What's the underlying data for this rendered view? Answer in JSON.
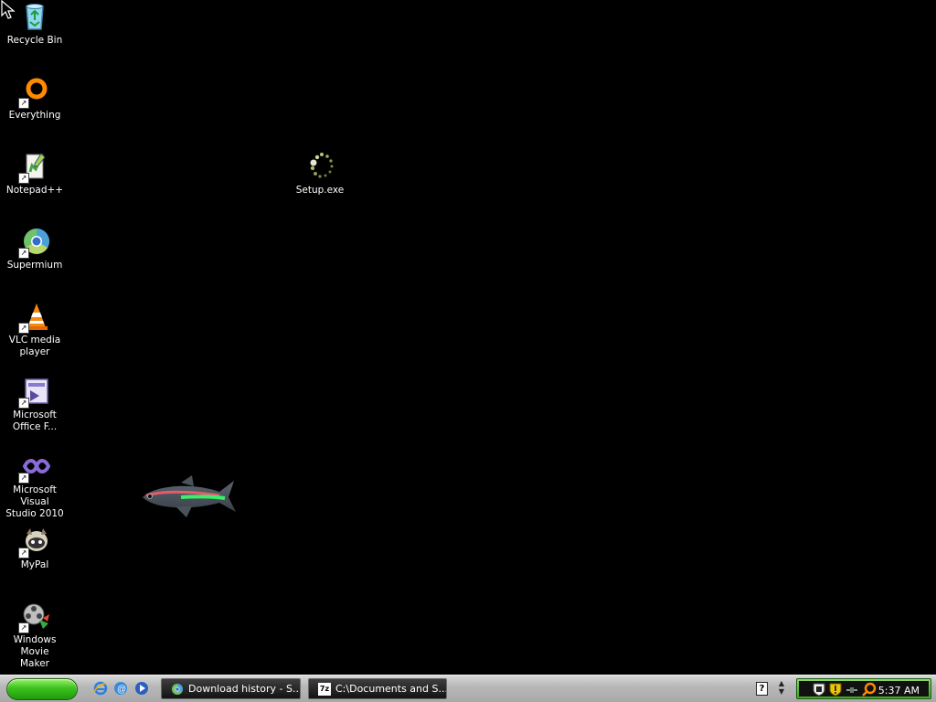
{
  "desktop": {
    "icons": [
      {
        "label": "Recycle Bin",
        "icon": "recycle-bin-icon"
      },
      {
        "label": "Everything",
        "icon": "everything-search-icon"
      },
      {
        "label": "Notepad++",
        "icon": "notepadpp-icon"
      },
      {
        "label": "Supermium",
        "icon": "supermium-browser-icon"
      },
      {
        "label": "VLC media\nplayer",
        "icon": "vlc-cone-icon"
      },
      {
        "label": "Microsoft\nOffice F...",
        "icon": "office-form-icon"
      },
      {
        "label": "Microsoft Visual\nStudio 2010",
        "icon": "visual-studio-icon"
      },
      {
        "label": "MyPal",
        "icon": "mypal-icon"
      },
      {
        "label": "Windows Movie\nMaker",
        "icon": "movie-maker-icon"
      },
      {
        "label": "Setup.exe",
        "icon": "setup-loading-icon"
      }
    ]
  },
  "taskbar": {
    "tasks": [
      {
        "label": "Download history - S...",
        "icon": "supermium-browser-icon"
      },
      {
        "label": "C:\\Documents and S...",
        "icon": "7zip-icon"
      }
    ],
    "clock": "5:37 AM",
    "help_glyph": "?",
    "sevenzip_glyph": "7z"
  },
  "colors": {
    "desktop_bg": "#000000",
    "start_green": "#3bc21c",
    "tray_green": "#40a625"
  }
}
